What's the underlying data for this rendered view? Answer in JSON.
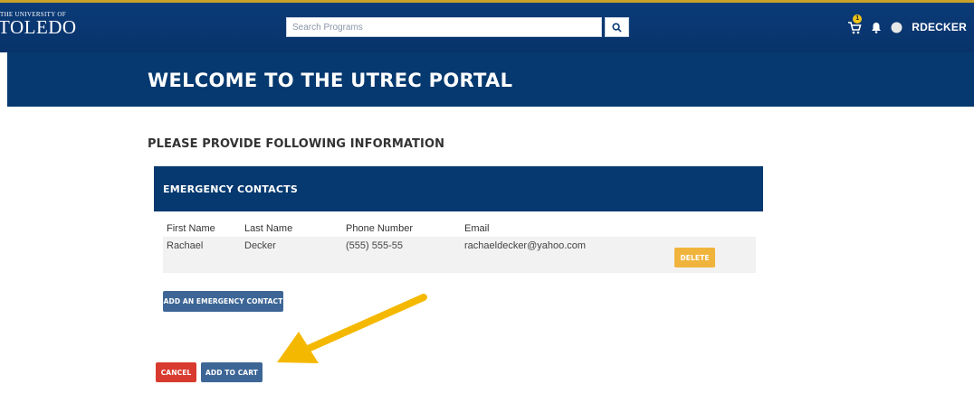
{
  "header": {
    "logo_small": "THE UNIVERSITY OF",
    "logo_big": "TOLEDO",
    "search_placeholder": "Search Programs",
    "cart_badge": "1",
    "username": "RDECKER"
  },
  "banner": {
    "title": "WELCOME TO THE UTREC PORTAL"
  },
  "form": {
    "title": "PLEASE PROVIDE FOLLOWING INFORMATION",
    "panel_title": "EMERGENCY CONTACTS",
    "columns": [
      "First Name",
      "Last Name",
      "Phone Number",
      "Email"
    ],
    "rows": [
      {
        "first_name": "Rachael",
        "last_name": "Decker",
        "phone": "(555) 555-55",
        "email": "rachaeldecker@yahoo.com",
        "delete_label": "DELETE"
      }
    ],
    "add_contact_label": "ADD AN EMERGENCY CONTACT",
    "cancel_label": "CANCEL",
    "add_to_cart_label": "ADD TO CART"
  },
  "colors": {
    "nav": "#08336a",
    "banner": "#05396f",
    "accent": "#f0b43c",
    "danger": "#d93a2f",
    "primary_button": "#3d6696",
    "arrow": "#f5b800"
  },
  "icons": [
    "search-icon",
    "cart-icon",
    "bell-icon",
    "user-avatar-icon",
    "annotation-arrow"
  ]
}
